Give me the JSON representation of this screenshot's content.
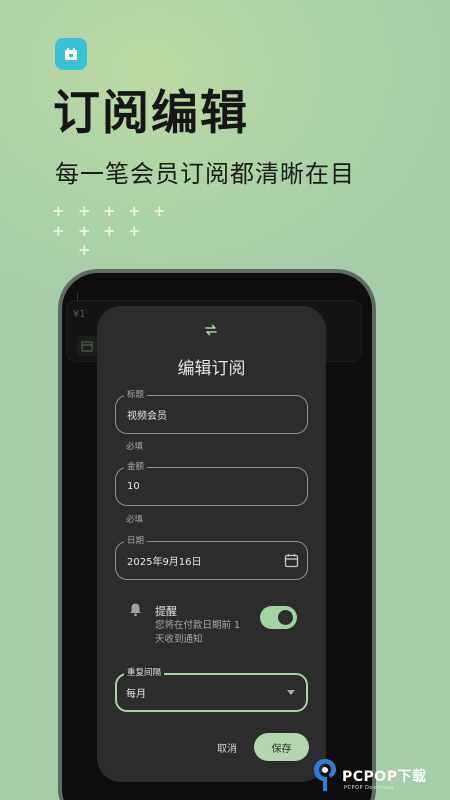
{
  "hero": {
    "title": "订阅编辑",
    "subtitle": "每一笔会员订阅都清晰在目"
  },
  "background_card": {
    "amount": "¥1"
  },
  "dialog": {
    "title": "编辑订阅",
    "fields": {
      "title": {
        "label": "标题",
        "value": "视频会员",
        "helper": "必填"
      },
      "amount": {
        "label": "金额",
        "value": "10",
        "helper": "必填"
      },
      "date": {
        "label": "日期",
        "value": "2025年9月16日"
      }
    },
    "reminder": {
      "title": "提醒",
      "description": "您将在付款日期前 1 天收到通知",
      "enabled": true
    },
    "repeat": {
      "label": "重复间隔",
      "value": "每月"
    },
    "actions": {
      "cancel": "取消",
      "save": "保存"
    }
  },
  "watermark": {
    "brand": "PCPOP下载",
    "tagline": "PCPOP Download"
  },
  "colors": {
    "accent": "#a4d3a2",
    "dialog_bg": "#2b2c2b",
    "app_icon": "#39c2d7"
  },
  "icons": [
    "app-icon",
    "swap-icon",
    "calendar-icon",
    "bell-icon",
    "dropdown-arrow-icon"
  ]
}
